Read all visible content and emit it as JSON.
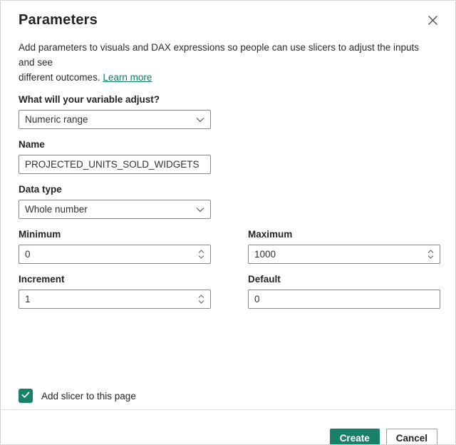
{
  "dialog": {
    "title": "Parameters",
    "description": {
      "line1": "Add parameters to visuals and DAX expressions so people can use slicers to adjust the inputs and see",
      "line2": "different outcomes.",
      "link_label": "Learn more"
    },
    "fields": {
      "adjust": {
        "label": "What will your variable adjust?",
        "value": "Numeric range"
      },
      "name": {
        "label": "Name",
        "value": "PROJECTED_UNITS_SOLD_WIDGETS"
      },
      "data_type": {
        "label": "Data type",
        "value": "Whole number"
      },
      "minimum": {
        "label": "Minimum",
        "value": "0"
      },
      "maximum": {
        "label": "Maximum",
        "value": "1000"
      },
      "increment": {
        "label": "Increment",
        "value": "1"
      },
      "default": {
        "label": "Default",
        "value": "0"
      }
    },
    "checkbox": {
      "label": "Add slicer to this page",
      "checked": true
    },
    "footer": {
      "create_label": "Create",
      "cancel_label": "Cancel"
    },
    "icons": {
      "close": "x-close",
      "chevron_down": "chevron-down",
      "chevron_up": "chevron-up",
      "checkmark": "check"
    },
    "colors": {
      "accent": "#19806A",
      "link": "#117865",
      "input_border": "#8a8886"
    }
  }
}
